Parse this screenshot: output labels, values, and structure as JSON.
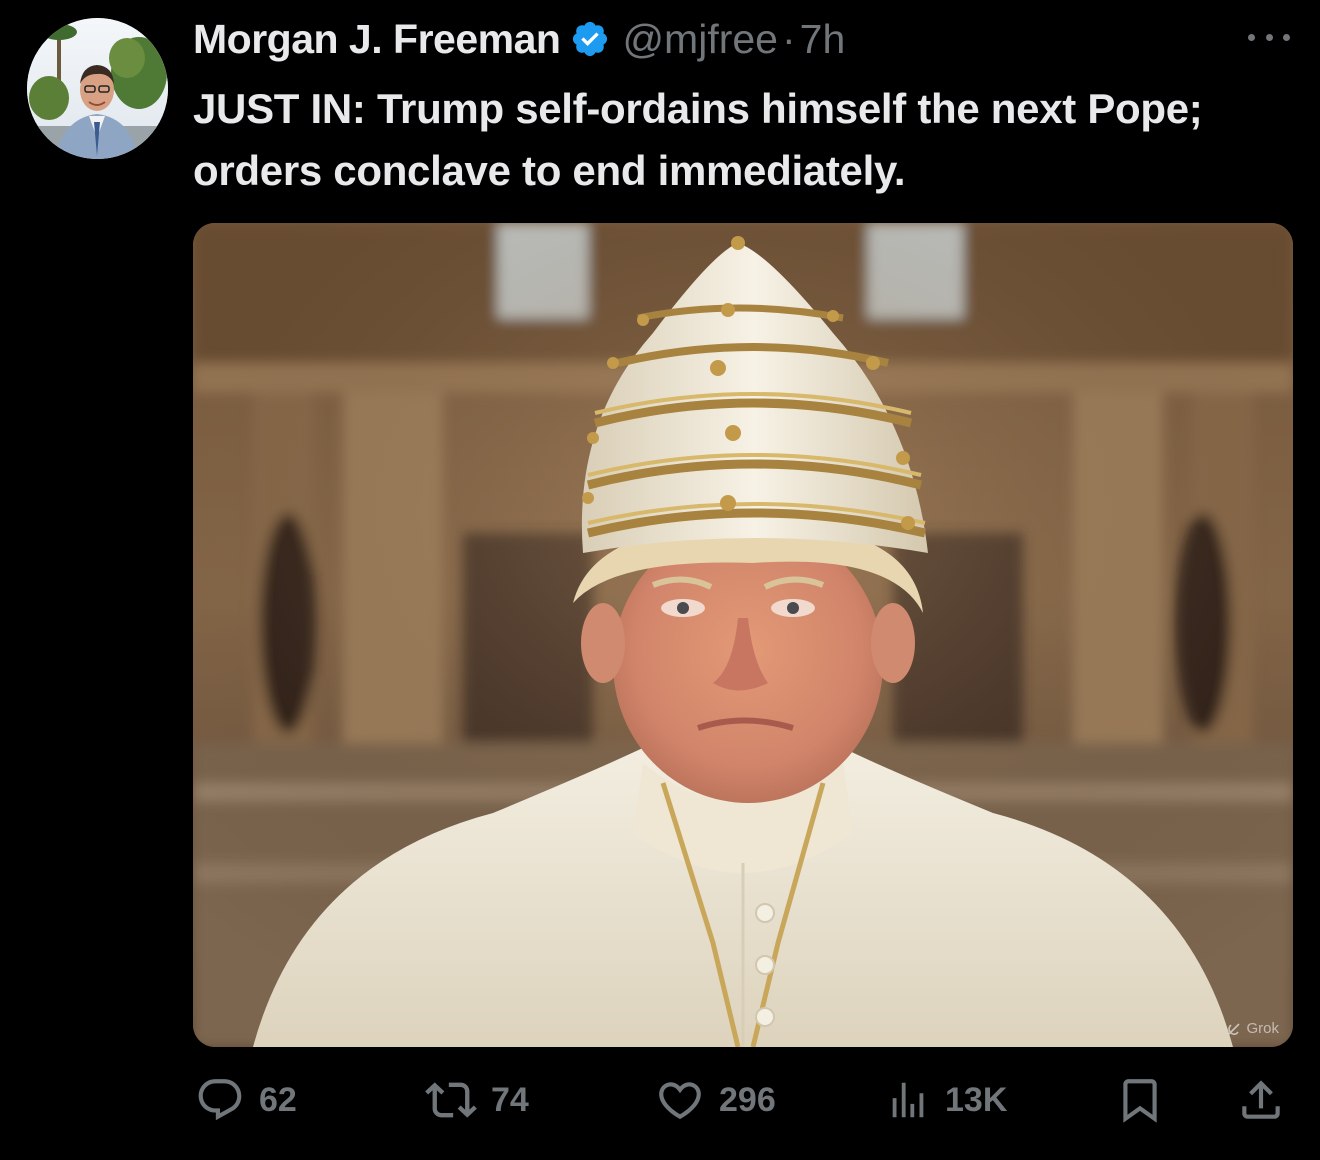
{
  "post": {
    "author_name": "Morgan J. Freeman",
    "author_handle": "@mjfree",
    "separator": "·",
    "time_ago": "7h",
    "text": "JUST IN: Trump self-ordains himself the next Pope; orders conclave to end immediately.",
    "media_badge": "Grok"
  },
  "actions": {
    "replies": "62",
    "reposts": "74",
    "likes": "296",
    "views": "13K"
  },
  "icons": {
    "verified": "verified-badge-icon",
    "more": "more-options-icon",
    "reply": "reply-bubble-icon",
    "repost": "repost-arrows-icon",
    "like": "heart-icon",
    "views": "analytics-bars-icon",
    "bookmark": "bookmark-icon",
    "share": "share-upload-icon"
  },
  "colors": {
    "background": "#000000",
    "text_primary": "#e7e9ea",
    "text_secondary": "#71767b",
    "verified_blue": "#1d9bf0"
  }
}
